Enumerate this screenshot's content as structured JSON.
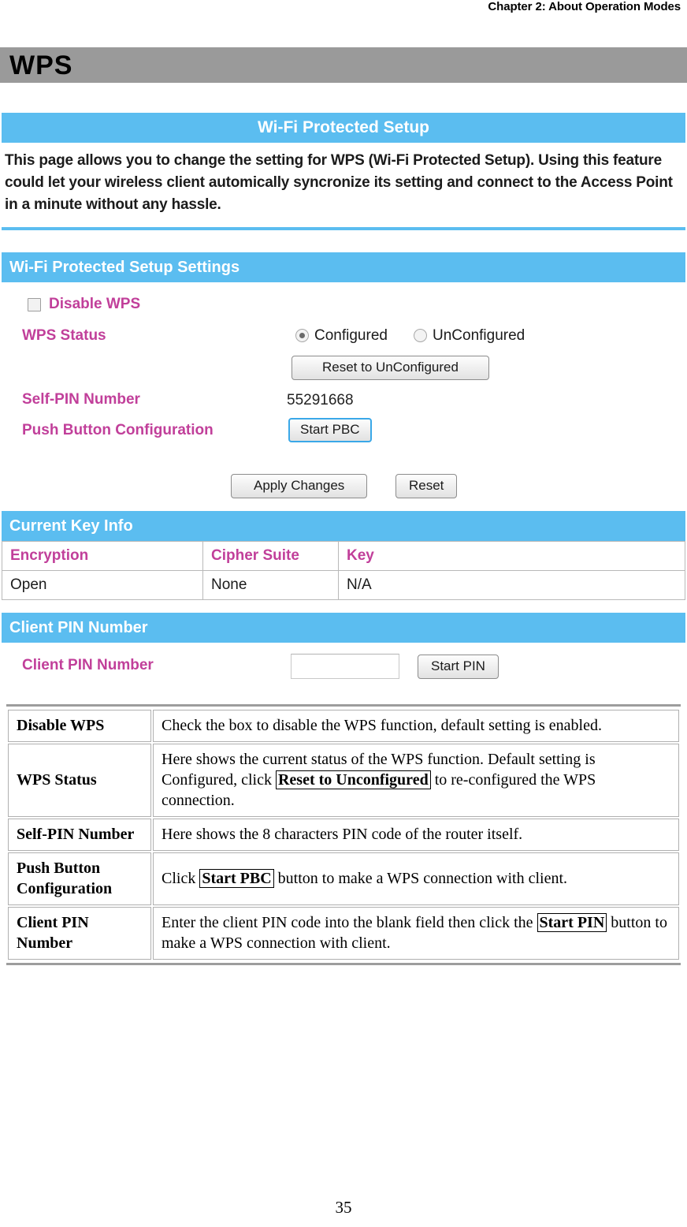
{
  "document": {
    "running_header": "Chapter 2: About Operation Modes",
    "section_title": "WPS",
    "page_number": "35"
  },
  "wps_panel": {
    "header": "Wi-Fi Protected Setup",
    "intro_paragraph": "This page allows you to change the setting for WPS (Wi-Fi Protected Setup). Using this feature could let your wireless client automically syncronize its setting and connect to the Access Point in a minute without any hassle."
  },
  "settings_panel": {
    "header": "Wi-Fi Protected Setup Settings",
    "disable_wps": {
      "label": "Disable WPS",
      "checked": false
    },
    "wps_status": {
      "label": "WPS Status",
      "options": [
        {
          "label": "Configured",
          "selected": true
        },
        {
          "label": "UnConfigured",
          "selected": false
        }
      ],
      "reset_button": "Reset to UnConfigured"
    },
    "self_pin": {
      "label": "Self-PIN Number",
      "value": "55291668"
    },
    "push_button_config": {
      "label": "Push Button Configuration",
      "button": "Start PBC"
    },
    "actions": {
      "apply": "Apply Changes",
      "reset": "Reset"
    }
  },
  "key_info_panel": {
    "header": "Current Key Info",
    "columns": [
      "Encryption",
      "Cipher Suite",
      "Key"
    ],
    "rows": [
      [
        "Open",
        "None",
        "N/A"
      ]
    ]
  },
  "client_pin_panel": {
    "header": "Client PIN Number",
    "label": "Client PIN Number",
    "input_value": "",
    "input_placeholder": "",
    "button": "Start PIN"
  },
  "description_table": {
    "rows": [
      {
        "term": "Disable WPS",
        "parts": [
          {
            "text": "Check the box to disable the WPS function, default setting is enabled.",
            "boxed": false
          }
        ]
      },
      {
        "term": "WPS Status",
        "parts": [
          {
            "text": "Here shows the current status of the WPS function. Default setting is Configured, click ",
            "boxed": false
          },
          {
            "text": "Reset to Unconfigured",
            "boxed": true
          },
          {
            "text": " to re-configured the WPS connection.",
            "boxed": false
          }
        ]
      },
      {
        "term": "Self-PIN Number",
        "parts": [
          {
            "text": "Here shows the 8 characters PIN code of the router itself.",
            "boxed": false
          }
        ]
      },
      {
        "term": "Push Button Configuration",
        "parts": [
          {
            "text": "Click ",
            "boxed": false
          },
          {
            "text": "Start PBC",
            "boxed": true
          },
          {
            "text": " button to make a WPS connection with client.",
            "boxed": false
          }
        ]
      },
      {
        "term": "Client PIN Number",
        "parts": [
          {
            "text": "Enter the client PIN code into the blank field then click the ",
            "boxed": false
          },
          {
            "text": "Start PIN",
            "boxed": true
          },
          {
            "text": " button to make a WPS connection with client.",
            "boxed": false
          }
        ]
      }
    ]
  },
  "colors": {
    "panel_header_blue": "#5bbdf0",
    "title_band_grey": "#9a9a9a",
    "label_pink": "#c13f9a"
  }
}
